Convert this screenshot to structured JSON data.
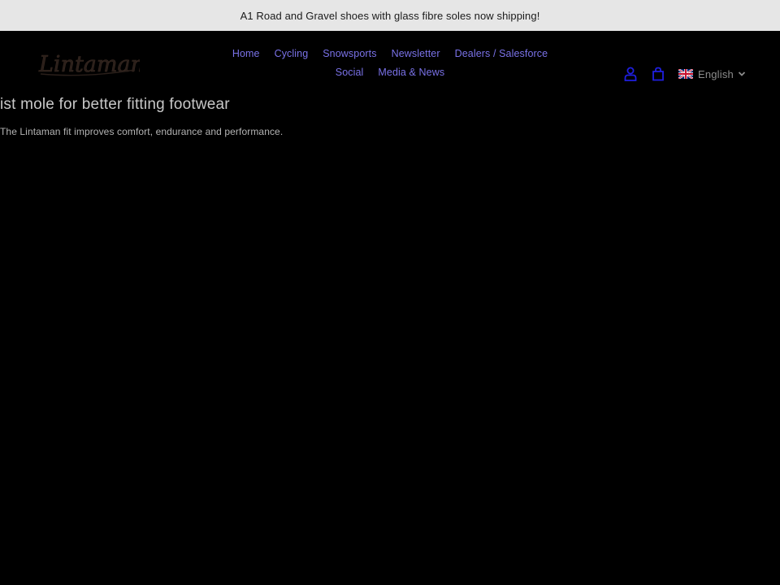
{
  "announcement": {
    "text": "A1 Road and Gravel shoes with glass fibre soles now shipping!"
  },
  "brand": {
    "logo_text": "Lintaman"
  },
  "nav": {
    "items": [
      {
        "label": "Home"
      },
      {
        "label": "Cycling"
      },
      {
        "label": "Snowsports"
      },
      {
        "label": "Newsletter"
      },
      {
        "label": "Dealers / Salesforce"
      },
      {
        "label": "Social"
      },
      {
        "label": "Media & News"
      }
    ]
  },
  "header_icons": {
    "account": "account-icon",
    "cart": "cart-icon"
  },
  "language": {
    "selected": "English",
    "flag": "uk-flag-icon"
  },
  "hero": {
    "title": "ist mole for better fitting footwear",
    "subtitle": "The Lintaman fit improves comfort, endurance and performance."
  },
  "colors": {
    "background": "#000000",
    "announcement_bg": "#e6e6e6",
    "nav_link": "#7a72e8",
    "icon_blue": "#1f1fe0"
  }
}
